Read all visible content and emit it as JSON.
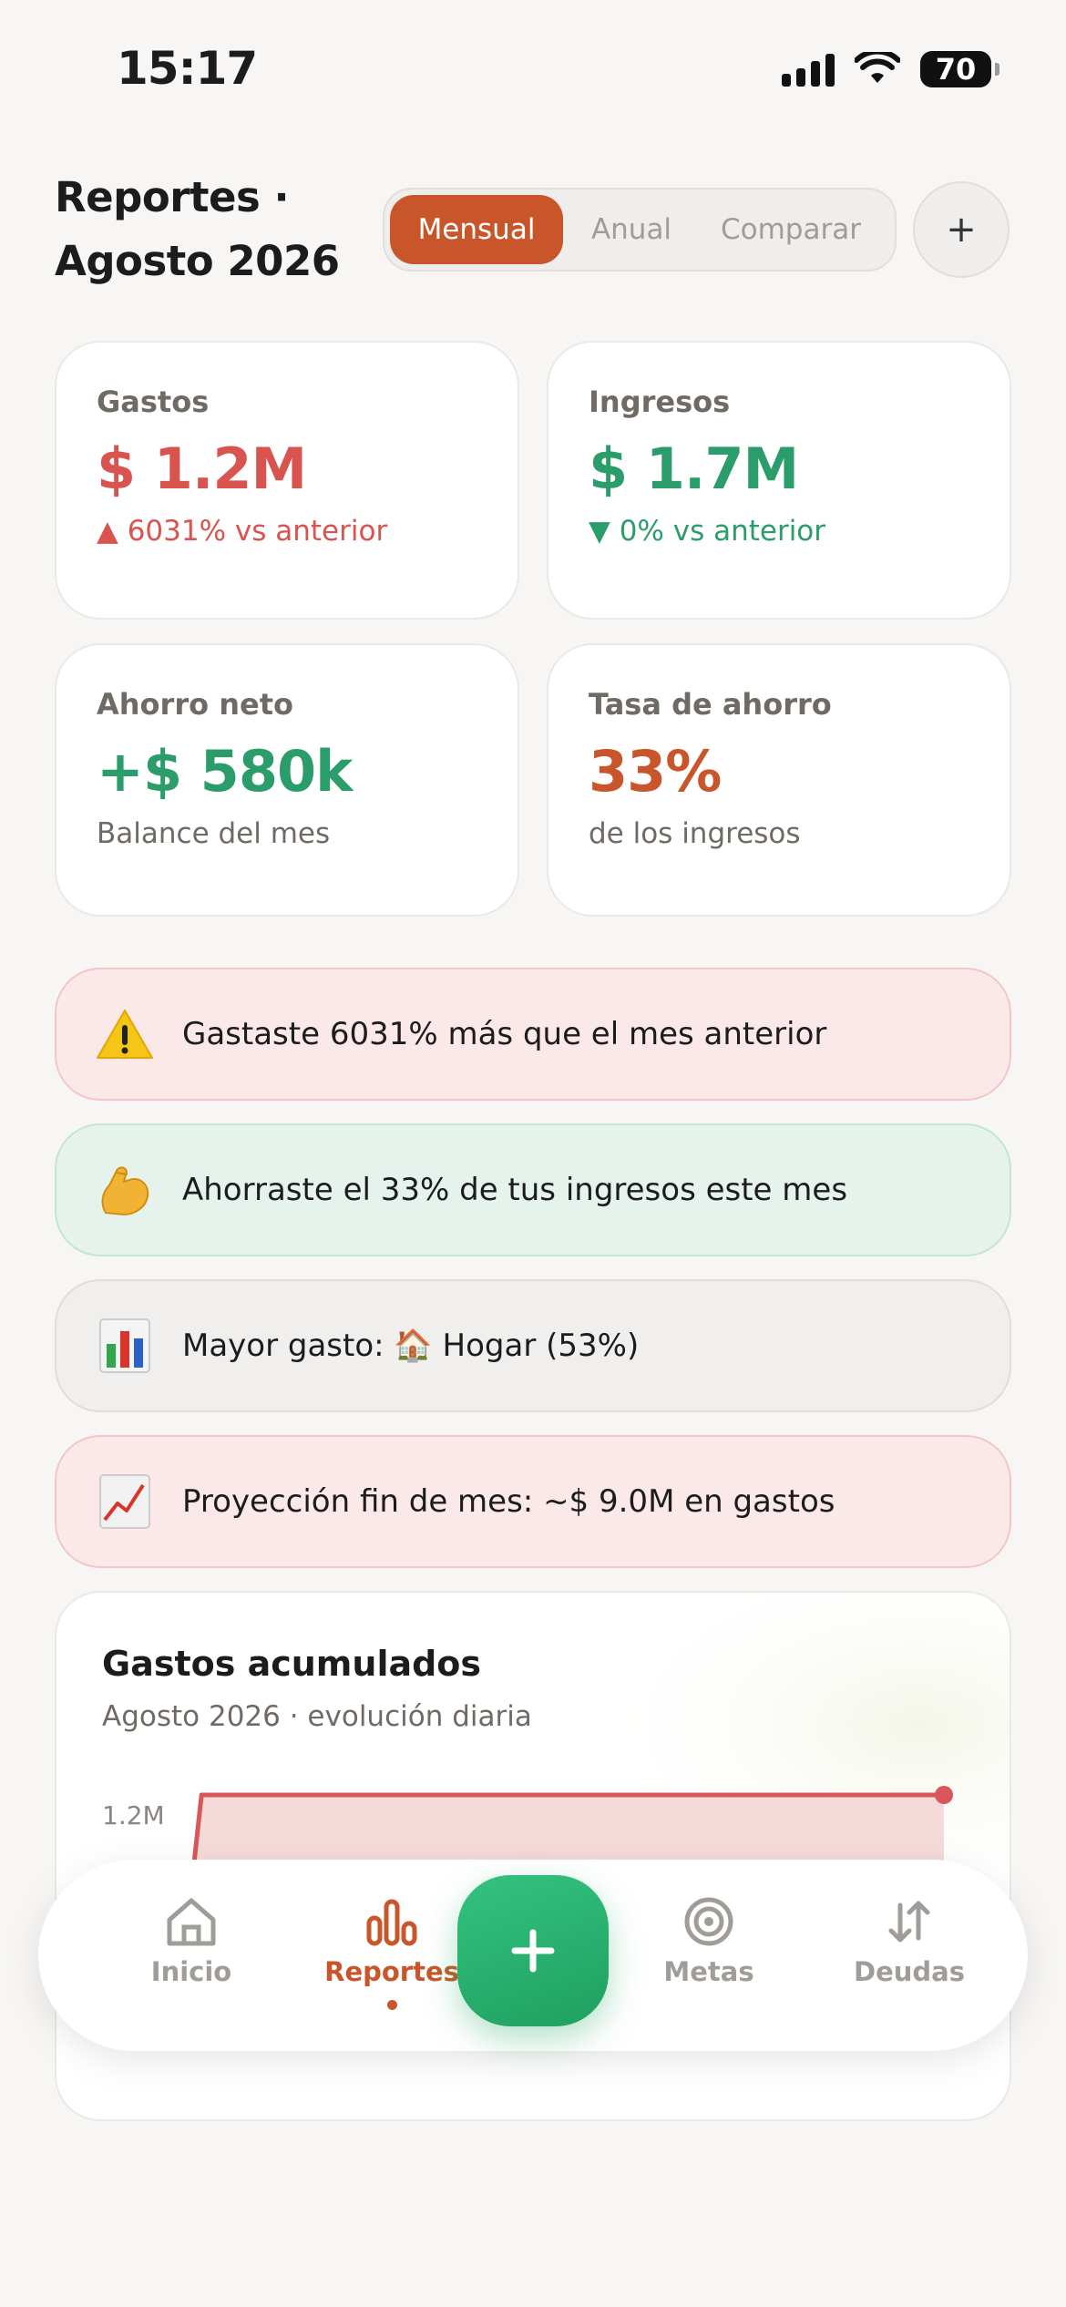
{
  "status_bar": {
    "time": "15:17",
    "battery": "70"
  },
  "header": {
    "title": "Reportes · Agosto 2026",
    "tabs": [
      {
        "label": "Mensual",
        "active": true
      },
      {
        "label": "Anual",
        "active": false
      },
      {
        "label": "Comparar",
        "active": false
      }
    ],
    "add_button": "+"
  },
  "stats": {
    "gastos": {
      "label": "Gastos",
      "value": "$ 1.2M",
      "change": "▲ 6031% vs anterior"
    },
    "ingresos": {
      "label": "Ingresos",
      "value": "$ 1.7M",
      "change": "▼ 0% vs anterior"
    },
    "ahorro": {
      "label": "Ahorro neto",
      "value": "+$ 580k",
      "sub": "Balance del mes"
    },
    "tasa": {
      "label": "Tasa de ahorro",
      "value": "33%",
      "sub": "de los ingresos"
    }
  },
  "insights": [
    {
      "icon": "warning-icon",
      "text": "Gastaste 6031% más que el mes anterior"
    },
    {
      "icon": "flexed-bicep-icon",
      "text": "Ahorraste el 33% de tus ingresos este mes"
    },
    {
      "icon": "bar-chart-icon",
      "text": "Mayor gasto: 🏠 Hogar (53%)"
    },
    {
      "icon": "trend-up-chart-icon",
      "text": "Proyección fin de mes: ~$ 9.0M en gastos"
    }
  ],
  "chart": {
    "title": "Gastos acumulados",
    "subtitle": "Agosto 2026 · evolución diaria",
    "y_tick_label": "1.2M"
  },
  "chart_data": {
    "type": "area",
    "title": "Gastos acumulados",
    "subtitle": "Agosto 2026 · evolución diaria",
    "x": [
      0,
      1,
      31
    ],
    "y": [
      0,
      1.2,
      1.2
    ],
    "ylabel": "",
    "yticks": [
      "1.2M"
    ]
  },
  "nav": {
    "items": [
      {
        "label": "Inicio",
        "icon": "home-icon",
        "active": false
      },
      {
        "label": "Reportes",
        "icon": "reports-icon",
        "active": true
      },
      {
        "label": "Metas",
        "icon": "target-icon",
        "active": false
      },
      {
        "label": "Deudas",
        "icon": "transfer-arrows-icon",
        "active": false
      }
    ],
    "fab": "+"
  },
  "colors": {
    "accent": "#c9562a",
    "expense_red": "#d9534f",
    "income_green": "#2a9d6a",
    "fab_green": "#2bb56f",
    "background": "#f7f6f4"
  }
}
